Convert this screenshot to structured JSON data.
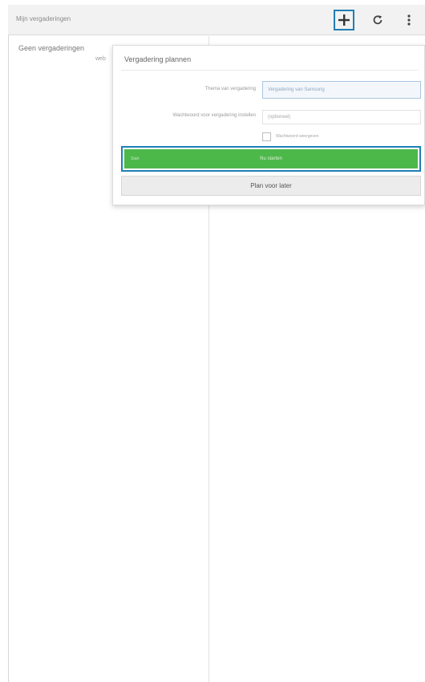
{
  "actionbar": {
    "title": "Mijn vergaderingen",
    "add_icon": "plus-icon",
    "refresh_icon": "refresh-icon",
    "menu_icon": "more-vertical-icon"
  },
  "left_pane": {
    "item_label": "Geen vergaderingen",
    "item_sub": "web"
  },
  "popup": {
    "title": "Vergadering plannen",
    "theme_label": "Thema van vergadering",
    "theme_value": "Vergadering van Samsung",
    "password_label": "Wachtwoord voor vergadering instellen",
    "password_placeholder": "(optioneel)",
    "checkbox_label": "Wachtwoord weergeven",
    "start_label": "Nu starten",
    "start_hint": "Start",
    "plan_label": "Plan voor later"
  },
  "colors": {
    "highlight": "#1f7fb5",
    "start_green": "#4db84a"
  }
}
